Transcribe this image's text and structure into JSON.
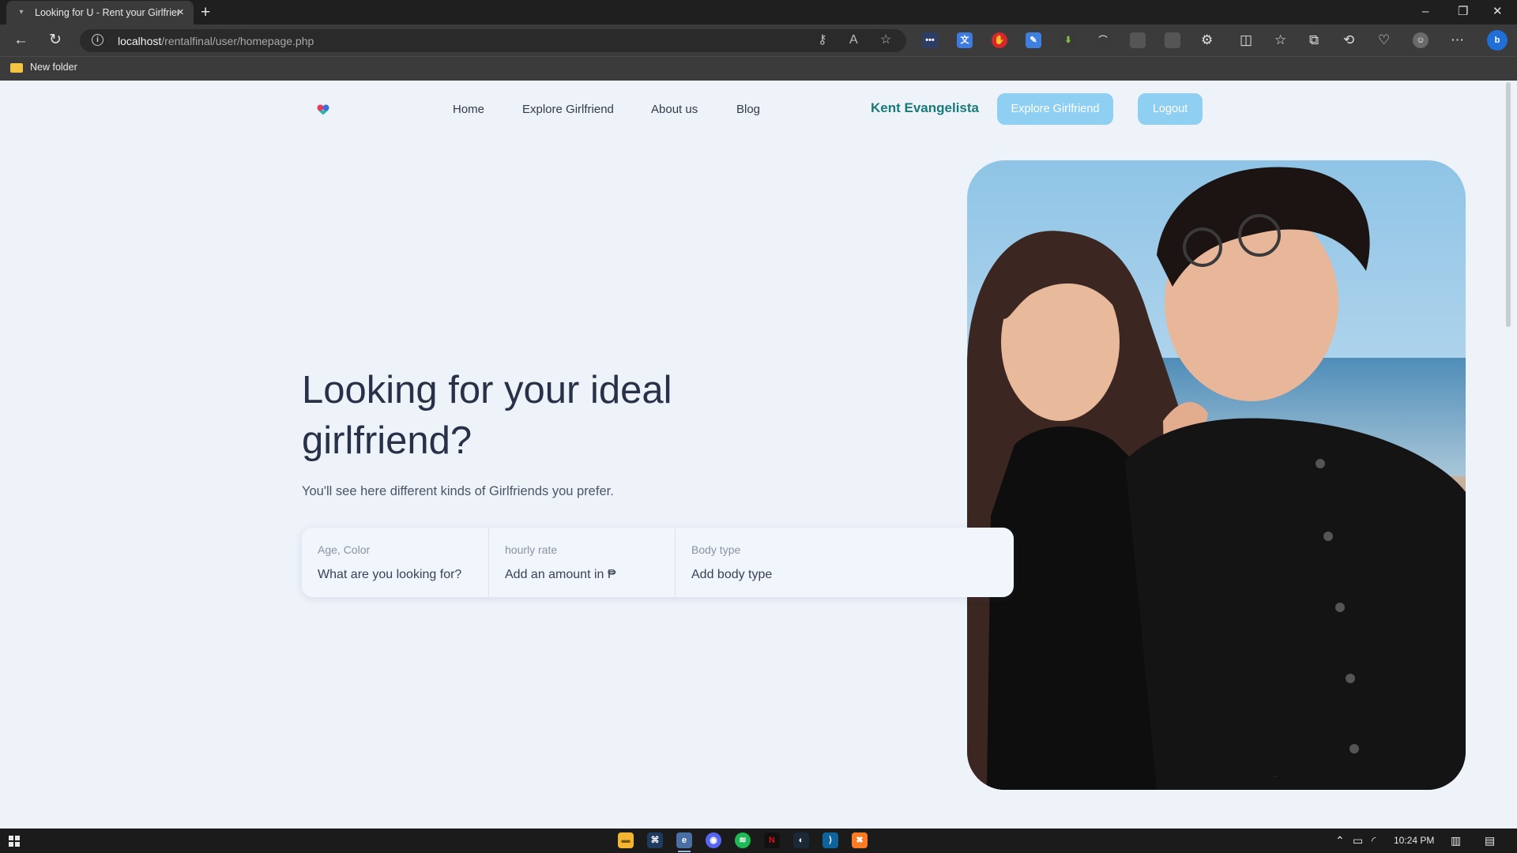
{
  "browser": {
    "tab_title": "Looking for U - Rent your Girlfriend",
    "tab_close": "×",
    "new_tab": "+",
    "url_host": "localhost",
    "url_path": "/rentalfinal/user/homepage.php",
    "bookmark": "New folder"
  },
  "nav": {
    "links": [
      "Home",
      "Explore Girlfriend",
      "About us",
      "Blog"
    ],
    "username": "Kent Evangelista",
    "explore_button": "Explore Girlfriend",
    "logout_button": "Logout"
  },
  "hero": {
    "title": "Looking for your ideal girlfriend?",
    "subtitle": "You'll see here different kinds of Girlfriends you prefer."
  },
  "search": {
    "segments": [
      {
        "label": "Age, Color",
        "value": "What are you looking for?"
      },
      {
        "label": "hourly rate",
        "value": "Add an amount in ₱"
      },
      {
        "label": "Body type",
        "value": "Add body type"
      }
    ]
  },
  "taskbar": {
    "time": "10:24 PM"
  },
  "icons": {
    "tab_favicon": "bookmark-icon",
    "back": "back-arrow-icon",
    "reload": "reload-icon",
    "info": "info-icon",
    "photo": "couple-beach-photo"
  },
  "colors": {
    "page_bg": "#eef2f9",
    "button_bg": "#8ecff2",
    "username": "#1a7a7a",
    "title": "#283148"
  }
}
